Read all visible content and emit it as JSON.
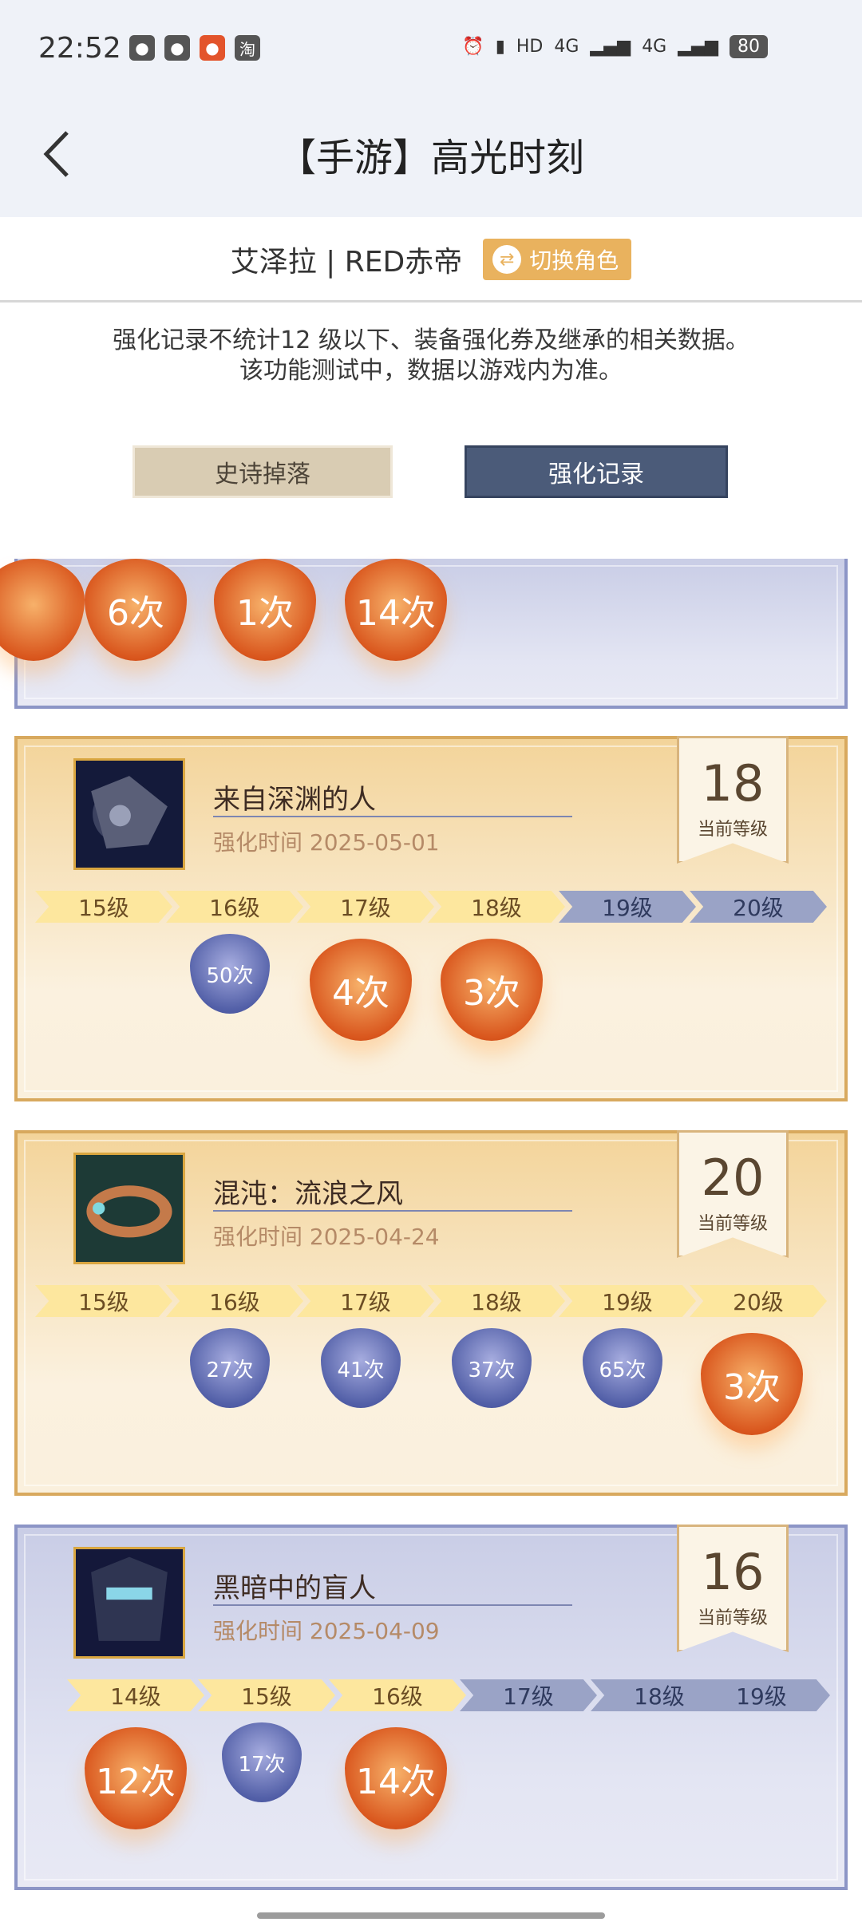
{
  "status": {
    "time": "22:52",
    "battery": "80",
    "net1": "HD",
    "net2": "4G",
    "net3": "4G"
  },
  "header": {
    "title": "【手游】高光时刻"
  },
  "role": {
    "name": "艾泽拉 | RED赤帝",
    "switch_label": "切换角色"
  },
  "notice": {
    "line1": "强化记录不统计12 级以下、装备强化券及继承的相关数据。",
    "line2": "该功能测试中，数据以游戏内为准。"
  },
  "tabs": {
    "epic": "史诗掉落",
    "enhance": "强化记录"
  },
  "partial_card": {
    "orbs": [
      "6次",
      "1次",
      "14次"
    ]
  },
  "cards": [
    {
      "name": "来自深渊的人",
      "date": "强化时间 2025-05-01",
      "level": "18",
      "level_label": "当前等级",
      "levels": [
        "15级",
        "16级",
        "17级",
        "18级",
        "19级",
        "20级"
      ],
      "orbs": [
        "50次",
        "4次",
        "3次"
      ]
    },
    {
      "name": "混沌：流浪之风",
      "date": "强化时间 2025-04-24",
      "level": "20",
      "level_label": "当前等级",
      "levels": [
        "15级",
        "16级",
        "17级",
        "18级",
        "19级",
        "20级"
      ],
      "orbs": [
        "27次",
        "41次",
        "37次",
        "65次",
        "3次"
      ]
    },
    {
      "name": "黑暗中的盲人",
      "date": "强化时间 2025-04-09",
      "level": "16",
      "level_label": "当前等级",
      "levels": [
        "14级",
        "15级",
        "16级",
        "17级",
        "18级",
        "19级"
      ],
      "orbs": [
        "12次",
        "17次",
        "14次"
      ]
    }
  ]
}
